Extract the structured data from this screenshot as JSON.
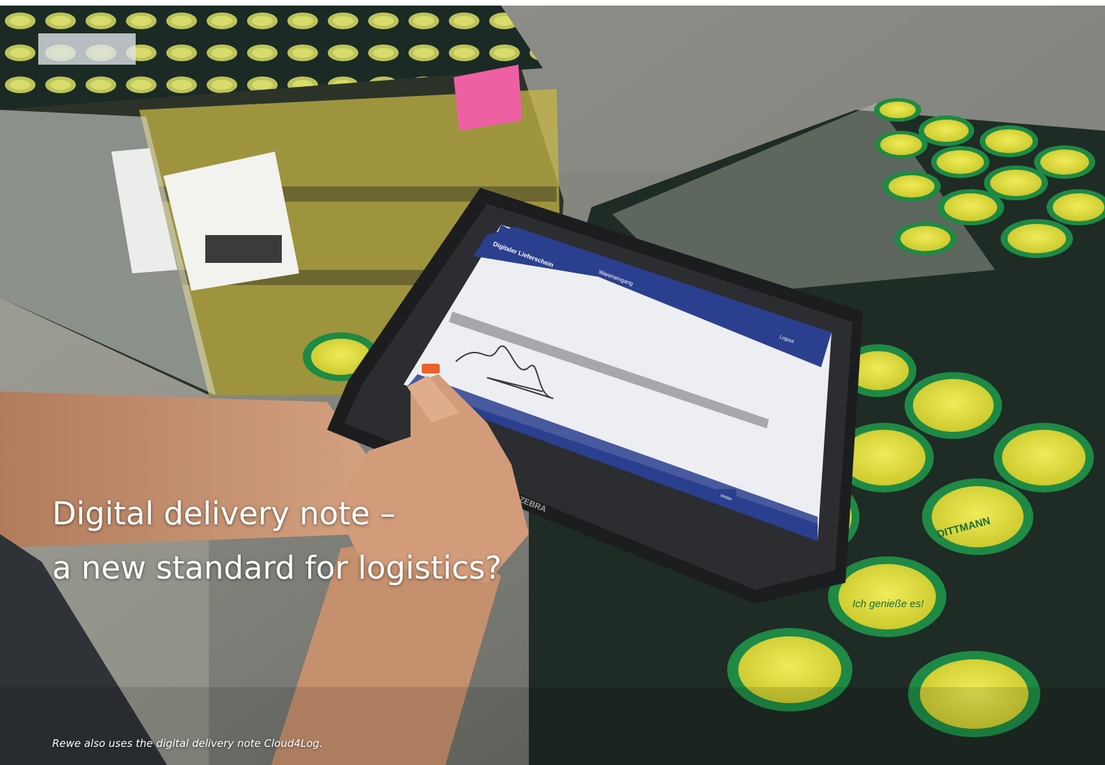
{
  "headline": {
    "line1": "Digital delivery note –",
    "line2": "a new standard for logistics?"
  },
  "caption": "Rewe also uses the digital delivery note Cloud4Log.",
  "tablet_screen": {
    "app_title": "Digitaler Lieferschein",
    "section_title": "Wareneingang",
    "logout_label": "Logout",
    "submit_label": "Weiter",
    "brand": "ZEBRA"
  },
  "jar_lid_text": {
    "brand": "DITTMANN",
    "slogan": "Ich genieße es!"
  },
  "colors": {
    "caption_text": "#ffffff",
    "app_header": "#2b3f8f",
    "lid_yellow": "#e4e23a",
    "lid_green": "#1e8a45"
  }
}
